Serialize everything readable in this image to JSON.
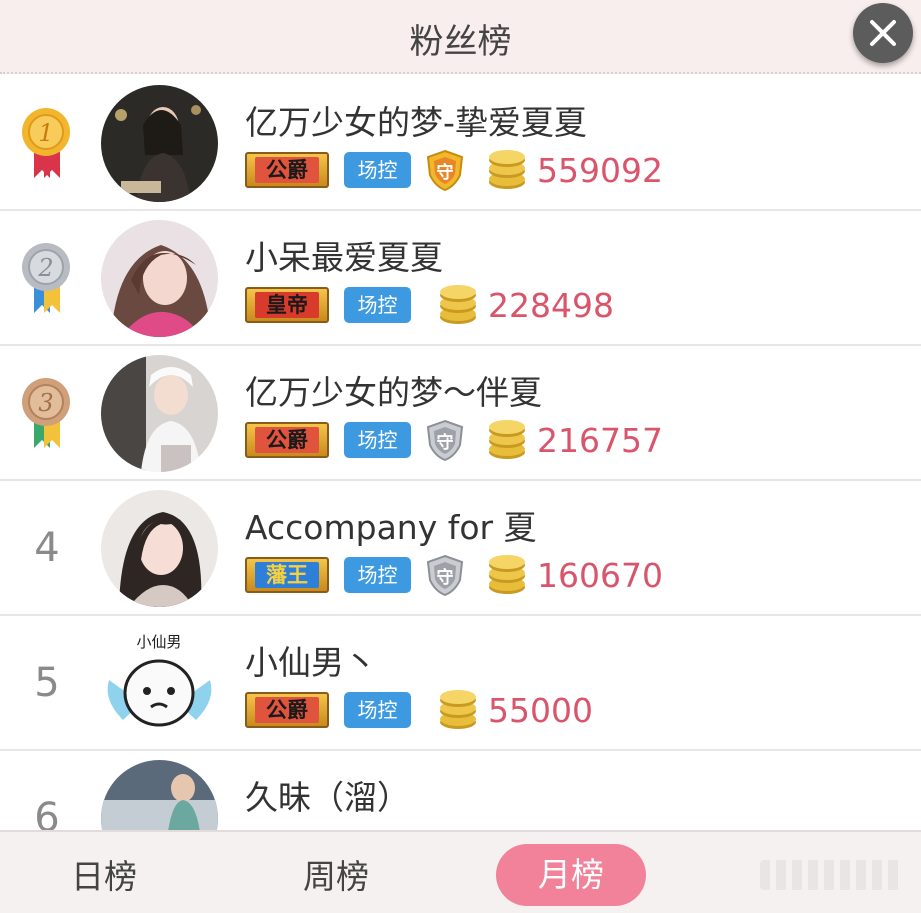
{
  "header": {
    "title": "粉丝榜"
  },
  "rows": [
    {
      "rank": "1",
      "name": "亿万少女的梦-挚爱夏夏",
      "title_badge": "公爵",
      "control_badge": "场控",
      "guard": "gold",
      "amount": "559092"
    },
    {
      "rank": "2",
      "name": "小呆最爱夏夏",
      "title_badge": "皇帝",
      "control_badge": "场控",
      "guard": "none",
      "amount": "228498"
    },
    {
      "rank": "3",
      "name": "亿万少女的梦～伴夏",
      "title_badge": "公爵",
      "control_badge": "场控",
      "guard": "silver",
      "amount": "216757"
    },
    {
      "rank": "4",
      "name": "Accompany for 夏",
      "title_badge": "藩王",
      "control_badge": "场控",
      "guard": "silver",
      "amount": "160670"
    },
    {
      "rank": "5",
      "name": "小仙男丶",
      "title_badge": "公爵",
      "control_badge": "场控",
      "guard": "none",
      "amount": "55000"
    },
    {
      "rank": "6",
      "name": "久昧（溜）",
      "title_badge": "",
      "control_badge": "",
      "guard": "none",
      "amount": ""
    }
  ],
  "avatar5_caption": "小仙男",
  "tabs": {
    "daily": "日榜",
    "weekly": "周榜",
    "monthly": "月榜"
  },
  "colors": {
    "accent": "#f2829a",
    "amount": "#d9556b",
    "control": "#3e9ae0"
  }
}
